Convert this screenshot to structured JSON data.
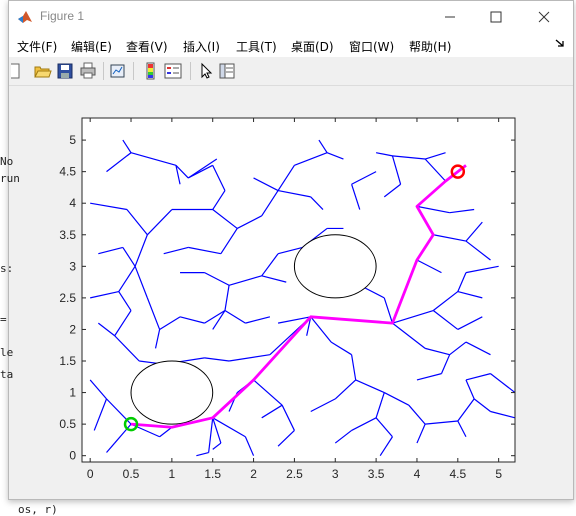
{
  "window": {
    "title": "Figure 1"
  },
  "menu": [
    "文件(F)",
    "编辑(E)",
    "查看(V)",
    "插入(I)",
    "工具(T)",
    "桌面(D)",
    "窗口(W)",
    "帮助(H)"
  ],
  "background_text": [
    "No",
    "run",
    "",
    "s:",
    "=",
    "le",
    "ta",
    "os, r)"
  ],
  "icons": {
    "toolbar": [
      "new-figure-icon",
      "open-file-icon",
      "save-icon",
      "print-icon",
      "link-plot-icon",
      "colorbar-icon",
      "legend-icon",
      "select-arrow-icon",
      "property-inspector-icon"
    ]
  },
  "chart_data": {
    "type": "scatter",
    "xlim": [
      -0.1,
      5.2
    ],
    "ylim": [
      -0.1,
      5.35
    ],
    "xticks": [
      "0",
      "0.5",
      "1",
      "1.5",
      "2",
      "2.5",
      "3",
      "3.5",
      "4",
      "4.5",
      "5"
    ],
    "yticks": [
      "0",
      "0.5",
      "1",
      "1.5",
      "2",
      "2.5",
      "3",
      "3.5",
      "4",
      "4.5",
      "5"
    ],
    "colors": {
      "tree": "#0000ff",
      "path": "#ff00ff",
      "start": "#00cc00",
      "goal": "#ff0000",
      "obstacle": "#000000"
    },
    "obstacles": [
      {
        "cx": 1.0,
        "cy": 1.0,
        "rx": 0.5,
        "ry": 0.5
      },
      {
        "cx": 3.0,
        "cy": 3.0,
        "rx": 0.5,
        "ry": 0.5
      }
    ],
    "start": [
      0.5,
      0.5
    ],
    "goal": [
      4.5,
      4.5
    ],
    "path": [
      [
        0.5,
        0.5
      ],
      [
        1.0,
        0.45
      ],
      [
        1.5,
        0.6
      ],
      [
        2.0,
        1.2
      ],
      [
        2.7,
        2.2
      ],
      [
        3.7,
        2.1
      ],
      [
        4.0,
        3.1
      ],
      [
        4.2,
        3.5
      ],
      [
        4.0,
        3.95
      ],
      [
        4.35,
        4.35
      ],
      [
        4.6,
        4.6
      ]
    ],
    "tree_edges": [
      [
        [
          0.5,
          0.5
        ],
        [
          0.85,
          0.3
        ]
      ],
      [
        [
          0.5,
          0.5
        ],
        [
          0.3,
          0.2
        ]
      ],
      [
        [
          0.5,
          0.5
        ],
        [
          0.2,
          0.9
        ]
      ],
      [
        [
          0.2,
          0.9
        ],
        [
          0.0,
          1.2
        ]
      ],
      [
        [
          0.2,
          0.9
        ],
        [
          0.05,
          0.4
        ]
      ],
      [
        [
          0.3,
          0.2
        ],
        [
          0.2,
          0.05
        ]
      ],
      [
        [
          0.85,
          0.3
        ],
        [
          1.0,
          0.45
        ]
      ],
      [
        [
          1.0,
          0.45
        ],
        [
          1.5,
          0.6
        ]
      ],
      [
        [
          1.5,
          0.6
        ],
        [
          1.45,
          0.05
        ]
      ],
      [
        [
          1.5,
          0.6
        ],
        [
          1.9,
          0.3
        ]
      ],
      [
        [
          1.9,
          0.3
        ],
        [
          2.0,
          0.0
        ]
      ],
      [
        [
          1.45,
          0.05
        ],
        [
          1.3,
          0.0
        ]
      ],
      [
        [
          1.5,
          0.6
        ],
        [
          1.6,
          0.2
        ]
      ],
      [
        [
          1.6,
          0.2
        ],
        [
          1.5,
          0.1
        ]
      ],
      [
        [
          2.0,
          1.2
        ],
        [
          2.35,
          0.8
        ]
      ],
      [
        [
          2.35,
          0.8
        ],
        [
          2.1,
          0.6
        ]
      ],
      [
        [
          2.35,
          0.8
        ],
        [
          2.5,
          0.4
        ]
      ],
      [
        [
          2.5,
          0.4
        ],
        [
          2.3,
          0.15
        ]
      ],
      [
        [
          2.0,
          1.2
        ],
        [
          1.8,
          1.0
        ]
      ],
      [
        [
          1.8,
          1.0
        ],
        [
          1.7,
          0.7
        ]
      ],
      [
        [
          2.7,
          2.2
        ],
        [
          2.2,
          1.6
        ]
      ],
      [
        [
          2.2,
          1.6
        ],
        [
          1.7,
          1.5
        ]
      ],
      [
        [
          1.7,
          1.5
        ],
        [
          1.4,
          1.55
        ]
      ],
      [
        [
          1.4,
          1.55
        ],
        [
          0.9,
          1.45
        ]
      ],
      [
        [
          0.9,
          1.45
        ],
        [
          0.6,
          1.5
        ]
      ],
      [
        [
          0.6,
          1.5
        ],
        [
          0.3,
          1.9
        ]
      ],
      [
        [
          0.3,
          1.9
        ],
        [
          0.1,
          2.1
        ]
      ],
      [
        [
          0.3,
          1.9
        ],
        [
          0.5,
          2.3
        ]
      ],
      [
        [
          0.5,
          2.3
        ],
        [
          0.35,
          2.6
        ]
      ],
      [
        [
          0.35,
          2.6
        ],
        [
          0.0,
          2.5
        ]
      ],
      [
        [
          0.35,
          2.6
        ],
        [
          0.55,
          3.0
        ]
      ],
      [
        [
          0.55,
          3.0
        ],
        [
          0.7,
          2.5
        ]
      ],
      [
        [
          0.55,
          3.0
        ],
        [
          0.4,
          3.3
        ]
      ],
      [
        [
          0.4,
          3.3
        ],
        [
          0.1,
          3.2
        ]
      ],
      [
        [
          0.55,
          3.0
        ],
        [
          0.7,
          3.5
        ]
      ],
      [
        [
          0.7,
          3.5
        ],
        [
          0.45,
          3.9
        ]
      ],
      [
        [
          0.45,
          3.9
        ],
        [
          0.0,
          4.0
        ]
      ],
      [
        [
          0.7,
          3.5
        ],
        [
          1.0,
          3.9
        ]
      ],
      [
        [
          1.0,
          3.9
        ],
        [
          1.5,
          3.9
        ]
      ],
      [
        [
          1.5,
          3.9
        ],
        [
          1.65,
          4.2
        ]
      ],
      [
        [
          1.65,
          4.2
        ],
        [
          1.5,
          4.6
        ]
      ],
      [
        [
          1.5,
          4.6
        ],
        [
          1.2,
          4.4
        ]
      ],
      [
        [
          1.2,
          4.4
        ],
        [
          1.05,
          4.6
        ]
      ],
      [
        [
          1.05,
          4.6
        ],
        [
          0.5,
          4.8
        ]
      ],
      [
        [
          0.5,
          4.8
        ],
        [
          0.2,
          4.5
        ]
      ],
      [
        [
          0.5,
          4.8
        ],
        [
          0.4,
          5.0
        ]
      ],
      [
        [
          1.05,
          4.6
        ],
        [
          1.1,
          4.3
        ]
      ],
      [
        [
          1.2,
          4.4
        ],
        [
          1.55,
          4.7
        ]
      ],
      [
        [
          1.5,
          3.9
        ],
        [
          1.8,
          3.6
        ]
      ],
      [
        [
          1.8,
          3.6
        ],
        [
          1.6,
          3.2
        ]
      ],
      [
        [
          1.6,
          3.2
        ],
        [
          1.2,
          3.3
        ]
      ],
      [
        [
          1.2,
          3.3
        ],
        [
          0.9,
          3.2
        ]
      ],
      [
        [
          1.8,
          3.6
        ],
        [
          2.1,
          3.8
        ]
      ],
      [
        [
          2.1,
          3.8
        ],
        [
          2.3,
          4.2
        ]
      ],
      [
        [
          2.3,
          4.2
        ],
        [
          2.0,
          4.4
        ]
      ],
      [
        [
          2.3,
          4.2
        ],
        [
          2.5,
          4.6
        ]
      ],
      [
        [
          2.5,
          4.6
        ],
        [
          2.9,
          4.8
        ]
      ],
      [
        [
          2.9,
          4.8
        ],
        [
          2.8,
          5.0
        ]
      ],
      [
        [
          2.9,
          4.8
        ],
        [
          3.1,
          4.7
        ]
      ],
      [
        [
          2.3,
          4.2
        ],
        [
          2.7,
          4.1
        ]
      ],
      [
        [
          2.7,
          4.1
        ],
        [
          2.85,
          3.9
        ]
      ],
      [
        [
          0.7,
          2.5
        ],
        [
          0.85,
          2.0
        ]
      ],
      [
        [
          0.85,
          2.0
        ],
        [
          0.8,
          1.7
        ]
      ],
      [
        [
          0.85,
          2.0
        ],
        [
          1.1,
          2.2
        ]
      ],
      [
        [
          1.1,
          2.2
        ],
        [
          1.4,
          2.1
        ]
      ],
      [
        [
          1.4,
          2.1
        ],
        [
          1.65,
          2.3
        ]
      ],
      [
        [
          1.65,
          2.3
        ],
        [
          1.5,
          2.0
        ]
      ],
      [
        [
          1.65,
          2.3
        ],
        [
          1.9,
          2.1
        ]
      ],
      [
        [
          1.9,
          2.1
        ],
        [
          2.2,
          2.2
        ]
      ],
      [
        [
          1.65,
          2.3
        ],
        [
          1.7,
          2.7
        ]
      ],
      [
        [
          1.7,
          2.7
        ],
        [
          1.4,
          2.9
        ]
      ],
      [
        [
          1.4,
          2.9
        ],
        [
          1.1,
          2.9
        ]
      ],
      [
        [
          1.7,
          2.7
        ],
        [
          2.1,
          2.85
        ]
      ],
      [
        [
          2.1,
          2.85
        ],
        [
          2.4,
          2.75
        ]
      ],
      [
        [
          2.1,
          2.85
        ],
        [
          2.3,
          3.2
        ]
      ],
      [
        [
          2.3,
          3.2
        ],
        [
          2.6,
          3.3
        ]
      ],
      [
        [
          2.7,
          2.2
        ],
        [
          2.95,
          1.8
        ]
      ],
      [
        [
          2.95,
          1.8
        ],
        [
          3.2,
          1.6
        ]
      ],
      [
        [
          3.2,
          1.6
        ],
        [
          3.25,
          1.2
        ]
      ],
      [
        [
          3.25,
          1.2
        ],
        [
          3.0,
          0.9
        ]
      ],
      [
        [
          3.0,
          0.9
        ],
        [
          2.7,
          0.7
        ]
      ],
      [
        [
          3.25,
          1.2
        ],
        [
          3.6,
          1.0
        ]
      ],
      [
        [
          3.6,
          1.0
        ],
        [
          3.5,
          0.6
        ]
      ],
      [
        [
          3.5,
          0.6
        ],
        [
          3.2,
          0.4
        ]
      ],
      [
        [
          3.2,
          0.4
        ],
        [
          3.0,
          0.2
        ]
      ],
      [
        [
          3.5,
          0.6
        ],
        [
          3.7,
          0.3
        ]
      ],
      [
        [
          3.7,
          0.3
        ],
        [
          3.55,
          0.0
        ]
      ],
      [
        [
          3.6,
          1.0
        ],
        [
          3.9,
          0.8
        ]
      ],
      [
        [
          3.9,
          0.8
        ],
        [
          4.1,
          0.5
        ]
      ],
      [
        [
          4.1,
          0.5
        ],
        [
          4.0,
          0.2
        ]
      ],
      [
        [
          4.1,
          0.5
        ],
        [
          4.5,
          0.55
        ]
      ],
      [
        [
          4.5,
          0.55
        ],
        [
          4.7,
          0.9
        ]
      ],
      [
        [
          4.7,
          0.9
        ],
        [
          4.9,
          0.7
        ]
      ],
      [
        [
          4.5,
          0.55
        ],
        [
          4.6,
          0.3
        ]
      ],
      [
        [
          4.9,
          0.7
        ],
        [
          5.2,
          0.6
        ]
      ],
      [
        [
          4.7,
          0.9
        ],
        [
          4.6,
          1.2
        ]
      ],
      [
        [
          4.6,
          1.2
        ],
        [
          4.9,
          1.3
        ]
      ],
      [
        [
          4.9,
          1.3
        ],
        [
          5.2,
          1.0
        ]
      ],
      [
        [
          3.7,
          2.1
        ],
        [
          4.1,
          1.7
        ]
      ],
      [
        [
          4.1,
          1.7
        ],
        [
          4.4,
          1.6
        ]
      ],
      [
        [
          4.4,
          1.6
        ],
        [
          4.6,
          1.8
        ]
      ],
      [
        [
          4.6,
          1.8
        ],
        [
          4.9,
          1.6
        ]
      ],
      [
        [
          4.4,
          1.6
        ],
        [
          4.3,
          1.3
        ]
      ],
      [
        [
          4.3,
          1.3
        ],
        [
          4.0,
          1.2
        ]
      ],
      [
        [
          3.7,
          2.1
        ],
        [
          4.2,
          2.3
        ]
      ],
      [
        [
          4.2,
          2.3
        ],
        [
          4.5,
          2.6
        ]
      ],
      [
        [
          4.5,
          2.6
        ],
        [
          4.8,
          2.5
        ]
      ],
      [
        [
          4.5,
          2.6
        ],
        [
          4.6,
          2.9
        ]
      ],
      [
        [
          4.6,
          2.9
        ],
        [
          5.0,
          3.0
        ]
      ],
      [
        [
          4.2,
          2.3
        ],
        [
          4.5,
          2.0
        ]
      ],
      [
        [
          4.5,
          2.0
        ],
        [
          4.8,
          2.2
        ]
      ],
      [
        [
          4.0,
          3.1
        ],
        [
          4.3,
          2.9
        ]
      ],
      [
        [
          4.2,
          3.5
        ],
        [
          4.6,
          3.4
        ]
      ],
      [
        [
          4.6,
          3.4
        ],
        [
          4.9,
          3.1
        ]
      ],
      [
        [
          4.6,
          3.4
        ],
        [
          4.8,
          3.7
        ]
      ],
      [
        [
          4.0,
          3.95
        ],
        [
          4.4,
          3.85
        ]
      ],
      [
        [
          4.4,
          3.85
        ],
        [
          4.7,
          3.9
        ]
      ],
      [
        [
          4.35,
          4.35
        ],
        [
          4.1,
          4.7
        ]
      ],
      [
        [
          4.1,
          4.7
        ],
        [
          3.7,
          4.75
        ]
      ],
      [
        [
          3.7,
          4.75
        ],
        [
          3.5,
          4.8
        ]
      ],
      [
        [
          3.7,
          4.75
        ],
        [
          3.8,
          4.3
        ]
      ],
      [
        [
          3.8,
          4.3
        ],
        [
          3.6,
          4.1
        ]
      ],
      [
        [
          4.1,
          4.7
        ],
        [
          4.35,
          4.8
        ]
      ],
      [
        [
          3.2,
          4.3
        ],
        [
          3.3,
          3.9
        ]
      ],
      [
        [
          3.2,
          4.3
        ],
        [
          3.5,
          4.5
        ]
      ],
      [
        [
          2.6,
          3.3
        ],
        [
          2.9,
          3.6
        ]
      ],
      [
        [
          2.9,
          3.6
        ],
        [
          3.1,
          3.6
        ]
      ],
      [
        [
          2.7,
          2.2
        ],
        [
          2.65,
          1.9
        ]
      ],
      [
        [
          2.7,
          2.2
        ],
        [
          2.3,
          2.1
        ]
      ],
      [
        [
          3.7,
          2.1
        ],
        [
          3.6,
          2.5
        ]
      ],
      [
        [
          3.6,
          2.5
        ],
        [
          3.3,
          2.7
        ]
      ]
    ]
  }
}
